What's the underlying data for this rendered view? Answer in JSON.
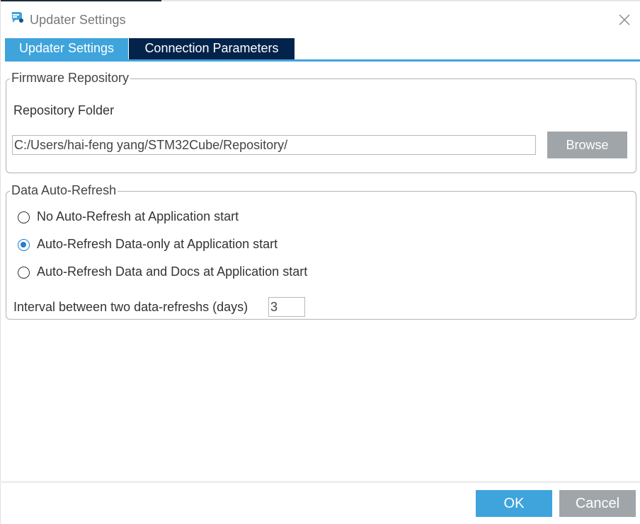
{
  "window": {
    "title": "Updater Settings",
    "app_icon": "stm32cube-updater-icon",
    "close_icon": "close-icon"
  },
  "tabs": [
    {
      "label": "Updater Settings",
      "active": true
    },
    {
      "label": "Connection Parameters",
      "active": false
    }
  ],
  "firmware_repository": {
    "legend": "Firmware Repository",
    "folder_label": "Repository Folder",
    "folder_value": "C:/Users/hai-feng yang/STM32Cube/Repository/",
    "browse_label": "Browse"
  },
  "data_auto_refresh": {
    "legend": "Data Auto-Refresh",
    "options": [
      {
        "label": "No Auto-Refresh at Application start",
        "selected": false
      },
      {
        "label": "Auto-Refresh Data-only at Application start",
        "selected": true
      },
      {
        "label": "Auto-Refresh Data and Docs at Application start",
        "selected": false
      }
    ],
    "interval_label": "Interval between two data-refreshs (days)",
    "interval_value": "3"
  },
  "buttons": {
    "ok": "OK",
    "cancel": "Cancel"
  },
  "colors": {
    "accent": "#3fa4dc",
    "tab_dark": "#03234b",
    "button_gray": "#9fa5a9",
    "radio_selected": "#1f7fd0"
  }
}
